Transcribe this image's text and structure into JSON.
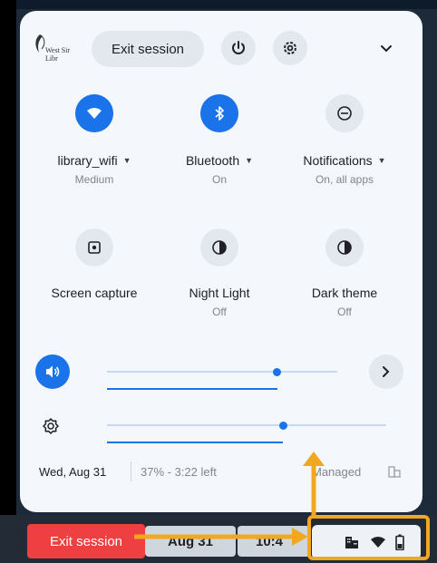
{
  "header": {
    "logo_text": "West Sir Libr",
    "exit_label": "Exit session"
  },
  "tiles": [
    {
      "label": "library_wifi",
      "sub": "Medium",
      "icon": "wifi-icon",
      "active": true
    },
    {
      "label": "Bluetooth",
      "sub": "On",
      "icon": "bluetooth-icon",
      "active": true
    },
    {
      "label": "Notifications",
      "sub": "On, all apps",
      "icon": "notifications-icon",
      "active": false
    },
    {
      "label": "Screen capture",
      "sub": "",
      "icon": "screen-capture-icon",
      "active": false
    },
    {
      "label": "Night Light",
      "sub": "Off",
      "icon": "night-light-icon",
      "active": false
    },
    {
      "label": "Dark theme",
      "sub": "Off",
      "icon": "dark-theme-icon",
      "active": false
    }
  ],
  "sliders": {
    "volume_level": 0.74,
    "brightness_level": 0.63
  },
  "footer": {
    "date": "Wed, Aug 31",
    "battery": "37% - 3:22 left",
    "managed": "Managed"
  },
  "shelf": {
    "exit_label": "Exit session",
    "date": "Aug 31",
    "time": "10:4"
  },
  "colors": {
    "accent": "#1a73e8",
    "annotation": "#f1a820",
    "exit_red": "#ee4040"
  }
}
